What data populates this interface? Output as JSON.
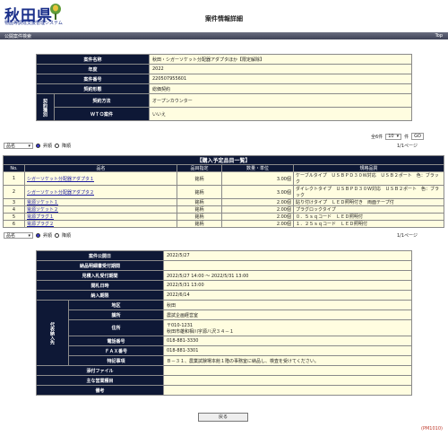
{
  "header": {
    "logo_title": "秋田県",
    "logo_sub": "物品等調達支援管理システム",
    "page_title": "案件情報詳細"
  },
  "navbar": {
    "left": "公開案件検索",
    "right": "Top"
  },
  "case": {
    "rows": [
      {
        "label": "案件名称",
        "value": "秋田・シガーソケット分配器アダプタほか【限定解除】"
      },
      {
        "label": "年度",
        "value": "2022"
      },
      {
        "label": "案件番号",
        "value": "220507955601"
      },
      {
        "label": "契約形態",
        "value": "総価契約"
      }
    ],
    "group_label": "契約種別",
    "method_label": "契約方法",
    "method_value": "オープンカウンター",
    "wto_label": "ＷＴＯ案件",
    "wto_value": "いいえ"
  },
  "paging": {
    "total_label": "全6件",
    "per_page": "10",
    "per_page_suffix": "件",
    "go": "GO",
    "sort_select": "品名",
    "asc_label": "昇順",
    "desc_label": "降順",
    "page": "1/1ページ"
  },
  "items": {
    "caption": "【購入予定品目一覧】",
    "headers": [
      "No.",
      "品名",
      "品目指定",
      "数量・単位",
      "規格品質"
    ],
    "rows": [
      {
        "no": "1",
        "name": "シガーソケット分配器アダプタ１",
        "spec": "銘柄",
        "qty": "3.00個",
        "quality": "ケーブルタイプ　ＵＳＢＰＤ３０Ｗ対応　ＵＳＢ２ポート　色：ブラック"
      },
      {
        "no": "2",
        "name": "シガーソケット分配器アダプタ２",
        "spec": "銘柄",
        "qty": "3.00個",
        "quality": "ダイレクトタイプ　ＵＳＢＰＤ３０Ｗ対応　ＵＳＢ２ポート　色：ブラック"
      },
      {
        "no": "3",
        "name": "電源ソケット１",
        "spec": "銘柄",
        "qty": "2.00個",
        "quality": "貼り付けタイプ　ＬＥＤ照明付き　両面テープ付"
      },
      {
        "no": "4",
        "name": "電源ソケット２",
        "spec": "銘柄",
        "qty": "2.00個",
        "quality": "プラグロックタイプ"
      },
      {
        "no": "5",
        "name": "電源プラグ１",
        "spec": "銘柄",
        "qty": "2.00個",
        "quality": "０．５ｓｑコード　ＬＥＤ照明付"
      },
      {
        "no": "6",
        "name": "電源プラグ２",
        "spec": "銘柄",
        "qty": "2.00個",
        "quality": "１．２５ｓｑコード　ＬＥＤ照明付"
      }
    ]
  },
  "details": {
    "rows": [
      {
        "label": "案件公開日",
        "value": "2022/5/27"
      },
      {
        "label": "納品明細書受付期間",
        "value": ""
      },
      {
        "label": "見積入札受付期間",
        "value": "2022/5/27 14:00 ～ 2022/5/31 13:00"
      },
      {
        "label": "開札日時",
        "value": "2022/5/31 13:00"
      },
      {
        "label": "納入期限",
        "value": "2022/6/14"
      }
    ],
    "group_label": "代表納入先",
    "group_rows": [
      {
        "label": "地区",
        "value": "秋田"
      },
      {
        "label": "課所",
        "value": "農試企画経営室"
      },
      {
        "label": "住所",
        "value": "〒010-1231",
        "value2": "秋田市雄和相川字源八沢３４－１"
      },
      {
        "label": "電話番号",
        "value": "018-881-3330"
      },
      {
        "label": "ＦＡＸ番号",
        "value": "018-881-3301"
      },
      {
        "label": "特記事項",
        "value": "Ｂ－３１、農業試験場本館１階の事務室に納品し、検査を受けてください。"
      }
    ],
    "tail_rows": [
      {
        "label": "添付ファイル",
        "value": ""
      },
      {
        "label": "主な営業種目",
        "value": ""
      },
      {
        "label": "備考",
        "value": ""
      }
    ]
  },
  "footer": {
    "back_label": "戻る",
    "page_id": "(PM1010)"
  }
}
